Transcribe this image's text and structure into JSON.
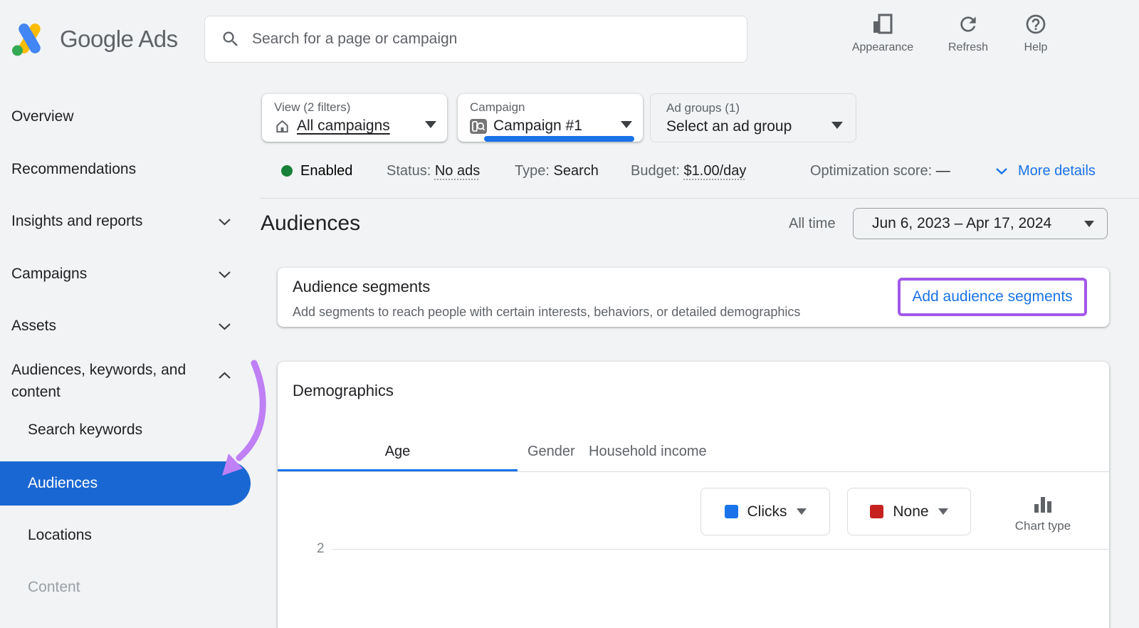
{
  "topbar": {
    "brand": "Google Ads",
    "search": {
      "placeholder": "Search for a page or campaign"
    },
    "actions": {
      "appearance": "Appearance",
      "refresh": "Refresh",
      "help": "Help"
    }
  },
  "sidebar": {
    "items": {
      "overview": "Overview",
      "recommendations": "Recommendations",
      "insights": "Insights and reports",
      "campaigns": "Campaigns",
      "assets": "Assets",
      "audiences_group": "Audiences, keywords, and content",
      "search_keywords": "Search keywords",
      "audiences": "Audiences",
      "locations": "Locations",
      "content": "Content"
    }
  },
  "filters": {
    "view": {
      "label": "View (2 filters)",
      "value": "All campaigns"
    },
    "campaign": {
      "label": "Campaign",
      "value": "Campaign #1"
    },
    "ad_groups": {
      "label": "Ad groups (1)",
      "value": "Select an ad group"
    }
  },
  "status_bar": {
    "enabled": "Enabled",
    "status_label": "Status:",
    "status_value": "No ads",
    "type_label": "Type:",
    "type_value": "Search",
    "budget_label": "Budget:",
    "budget_value": "$1.00/day",
    "optimization_label": "Optimization score:",
    "optimization_value": "—",
    "more_details": "More details"
  },
  "page_header": {
    "title": "Audiences",
    "date_preset": "All time",
    "date_range": "Jun 6, 2023 – Apr 17, 2024"
  },
  "audience_segments": {
    "title": "Audience segments",
    "subtitle": "Add segments to reach people with certain interests, behaviors, or detailed demographics",
    "cta": "Add audience segments"
  },
  "demographics": {
    "title": "Demographics",
    "tabs": {
      "age": "Age",
      "gender": "Gender",
      "household_income": "Household income"
    },
    "metric_primary": "Clicks",
    "metric_secondary": "None",
    "chart_type_label": "Chart type",
    "chart": {
      "type": "bar",
      "visible_y_tick": "2",
      "series_colors": {
        "clicks": "#1a73e8",
        "none": "#c5221f"
      }
    }
  },
  "colors": {
    "accent_blue": "#1a73e8",
    "selected_nav_blue": "#1967d2",
    "status_green": "#188038",
    "secondary_metric_red": "#c5221f",
    "annotation_arrow_purple": "#bf7ff5",
    "highlight_box_purple": "#a259e8"
  }
}
